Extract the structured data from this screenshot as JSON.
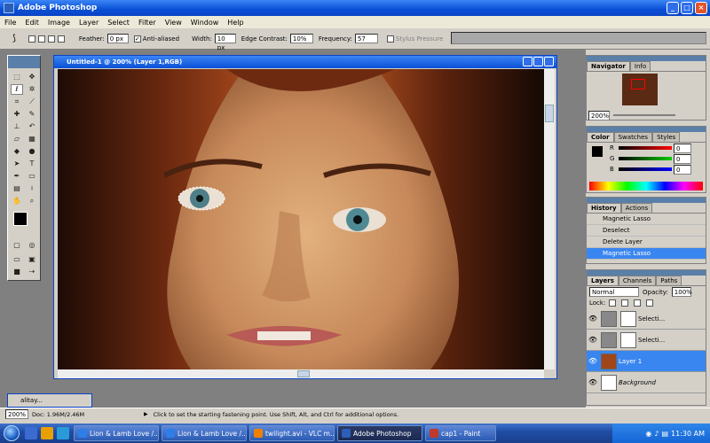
{
  "app": {
    "title": "Adobe Photoshop"
  },
  "menu": [
    "File",
    "Edit",
    "Image",
    "Layer",
    "Select",
    "Filter",
    "View",
    "Window",
    "Help"
  ],
  "options": {
    "feather_label": "Feather:",
    "feather_value": "0 px",
    "antialiased_label": "Anti-aliased",
    "width_label": "Width:",
    "width_value": "10 px",
    "edge_label": "Edge Contrast:",
    "edge_value": "10%",
    "freq_label": "Frequency:",
    "freq_value": "57",
    "stylus_label": "Stylus Pressure"
  },
  "document": {
    "title": "Untitled-1 @ 200% (Layer 1,RGB)"
  },
  "minidoc": {
    "title": "alitay..."
  },
  "navigator": {
    "tabs": [
      "Navigator",
      "Info"
    ],
    "zoom": "200%"
  },
  "color": {
    "tabs": [
      "Color",
      "Swatches",
      "Styles"
    ],
    "r_label": "R",
    "g_label": "G",
    "b_label": "B",
    "r": "0",
    "g": "0",
    "b": "0"
  },
  "history": {
    "tabs": [
      "History",
      "Actions"
    ],
    "items": [
      "Magnetic Lasso",
      "Deselect",
      "Delete Layer",
      "Magnetic Lasso"
    ]
  },
  "layers": {
    "tabs": [
      "Layers",
      "Channels",
      "Paths"
    ],
    "mode": "Normal",
    "opacity_label": "Opacity:",
    "opacity": "100%",
    "lock_label": "Lock:",
    "items": [
      "Selecti...",
      "Selecti...",
      "Layer 1",
      "Background"
    ]
  },
  "status": {
    "zoom": "200%",
    "doc": "Doc: 1.96M/2.46M",
    "hint": "Click to set the starting fastening point. Use Shift, Alt, and Ctrl for additional options."
  },
  "taskbar": {
    "tasks": [
      "Lion & Lamb Love /...",
      "Lion & Lamb Love /...",
      "twilight.avi - VLC m...",
      "Adobe Photoshop",
      "cap1 - Paint"
    ],
    "clock": "11:30 AM"
  },
  "colors": {
    "accent": "#0a4fd6",
    "selected": "#3a86f0"
  }
}
